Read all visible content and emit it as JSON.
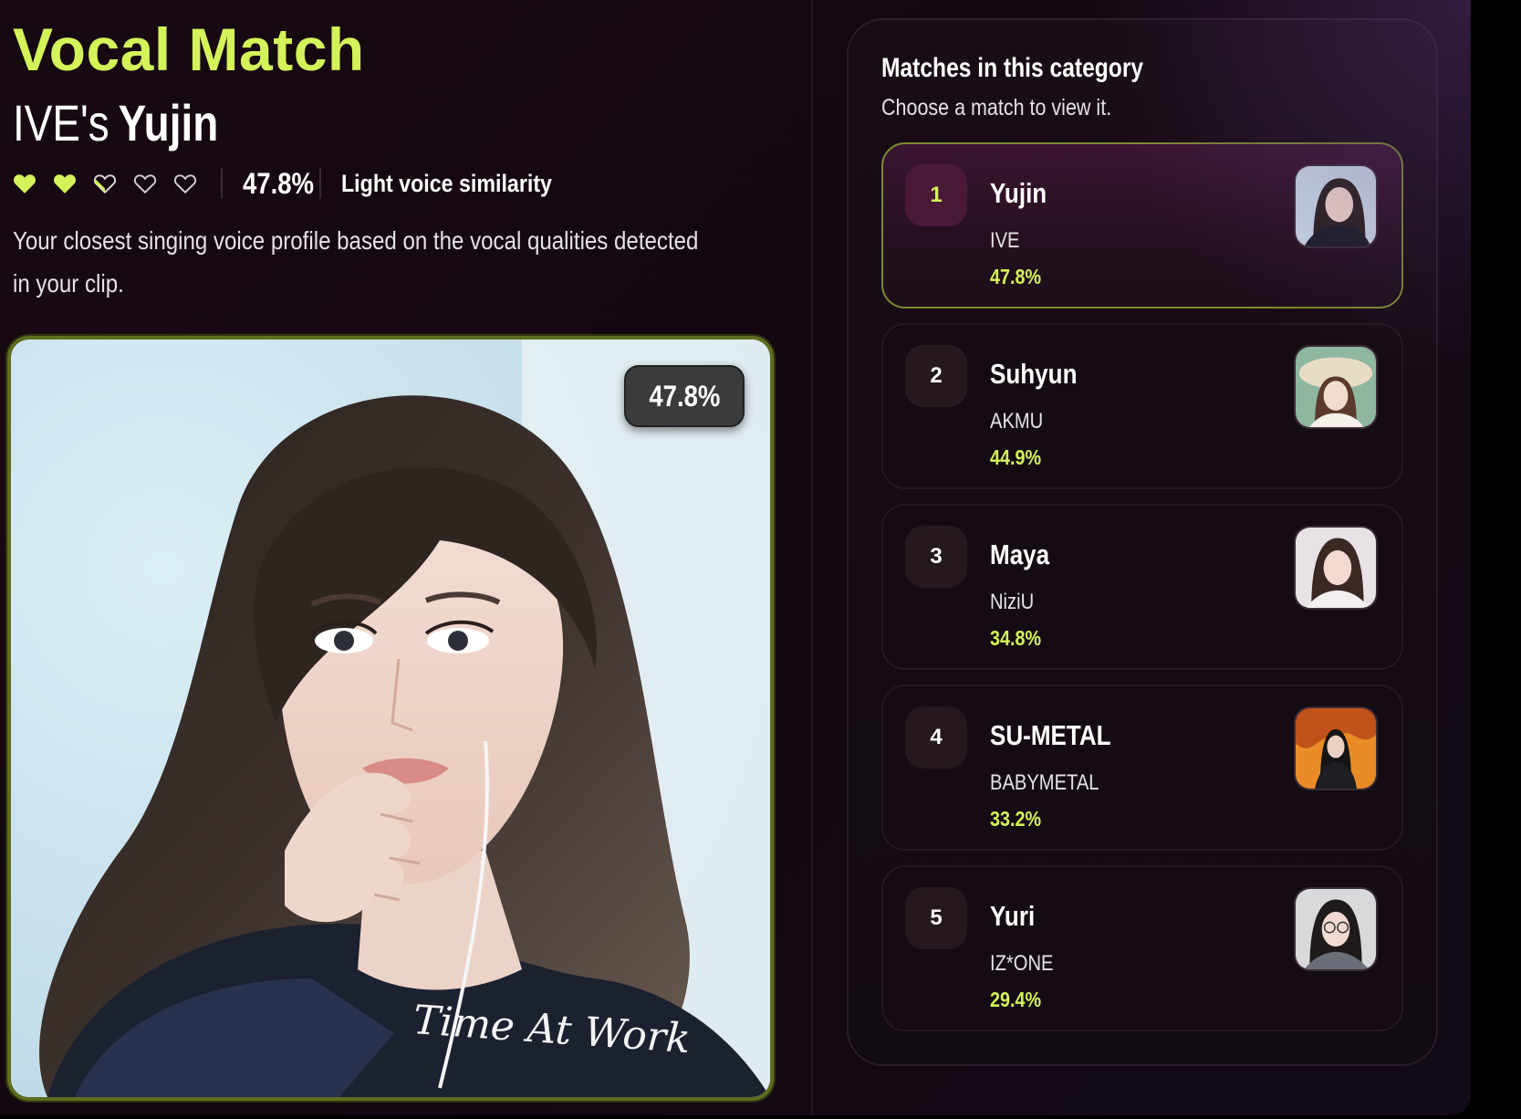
{
  "header": {
    "title": "Vocal Match",
    "group_prefix": "IVE's",
    "artist_name": "Yujin"
  },
  "rating": {
    "hearts_filled": 2,
    "hearts_total": 5,
    "percent": "47.8%",
    "label": "Light voice similarity"
  },
  "description": "Your closest singing voice profile based on the vocal qualities detected in your clip.",
  "photo": {
    "badge": "47.8%",
    "caption_text": "Time At Work"
  },
  "panel": {
    "title": "Matches in this category",
    "subtitle": "Choose a match to view it.",
    "matches": [
      {
        "rank": "1",
        "name": "Yujin",
        "group": "IVE",
        "percent": "47.8%",
        "active": true
      },
      {
        "rank": "2",
        "name": "Suhyun",
        "group": "AKMU",
        "percent": "44.9%",
        "active": false
      },
      {
        "rank": "3",
        "name": "Maya",
        "group": "NiziU",
        "percent": "34.8%",
        "active": false
      },
      {
        "rank": "4",
        "name": "SU-METAL",
        "group": "BABYMETAL",
        "percent": "33.2%",
        "active": false
      },
      {
        "rank": "5",
        "name": "Yuri",
        "group": "IZ*ONE",
        "percent": "29.4%",
        "active": false
      }
    ]
  },
  "colors": {
    "accent": "#d4f25a",
    "background": "#150a12",
    "card_border_active": "#7c8a33"
  }
}
